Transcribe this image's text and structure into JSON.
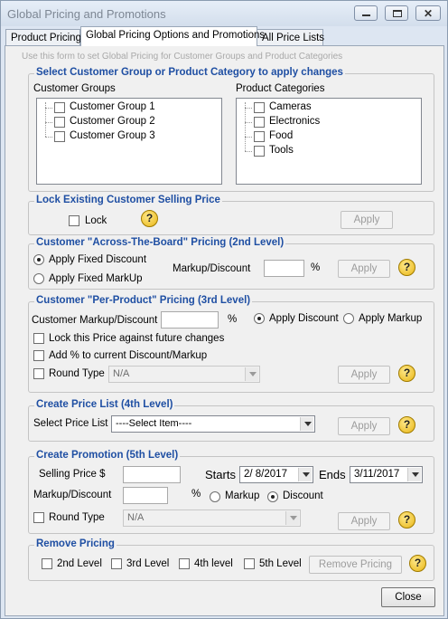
{
  "window": {
    "title": "Global Pricing and Promotions"
  },
  "tabs": [
    {
      "label": "Product Pricing"
    },
    {
      "label": "Global Pricing Options and Promotions"
    },
    {
      "label": "All Price Lists"
    }
  ],
  "hint": "Use this form to set Global Pricing for Customer Groups and Product Categories",
  "select_group": {
    "title": "Select Customer Group or Product Category to apply changes",
    "customer_groups_label": "Customer Groups",
    "customer_groups": [
      "Customer Group 1",
      "Customer Group 2",
      "Customer Group 3"
    ],
    "product_categories_label": "Product Categories",
    "product_categories": [
      "Cameras",
      "Electronics",
      "Food",
      "Tools"
    ]
  },
  "lock_group": {
    "title": "Lock Existing Customer Selling Price",
    "lock_label": "Lock",
    "apply_label": "Apply",
    "help": "?"
  },
  "level2": {
    "title": "Customer \"Across-The-Board\" Pricing (2nd Level)",
    "fixed_discount": "Apply Fixed Discount",
    "fixed_markup": "Apply Fixed MarkUp",
    "markup_discount_label": "Markup/Discount",
    "percent": "%",
    "apply_label": "Apply",
    "help": "?"
  },
  "level3": {
    "title": "Customer \"Per-Product\" Pricing (3rd Level)",
    "markup_discount_label": "Customer Markup/Discount",
    "percent": "%",
    "apply_discount": "Apply Discount",
    "apply_markup": "Apply Markup",
    "lock_future": "Lock this Price against future changes",
    "add_percent": "Add % to current Discount/Markup",
    "round_type_label": "Round Type",
    "round_type_value": "N/A",
    "apply_label": "Apply",
    "help": "?"
  },
  "level4": {
    "title": "Create Price List (4th Level)",
    "select_label": "Select Price List",
    "select_value": "----Select Item----",
    "apply_label": "Apply",
    "help": "?"
  },
  "level5": {
    "title": "Create Promotion (5th Level)",
    "selling_price_label": "Selling Price $",
    "starts_label": "Starts",
    "starts_value": "2/ 8/2017",
    "ends_label": "Ends",
    "ends_value": "3/11/2017",
    "markup_discount_label": "Markup/Discount",
    "percent": "%",
    "markup": "Markup",
    "discount": "Discount",
    "round_type_label": "Round Type",
    "round_type_value": "N/A",
    "apply_label": "Apply",
    "help": "?"
  },
  "remove": {
    "title": "Remove Pricing",
    "levels": [
      "2nd Level",
      "3rd Level",
      "4th level",
      "5th Level"
    ],
    "button": "Remove Pricing",
    "help": "?"
  },
  "close_label": "Close"
}
